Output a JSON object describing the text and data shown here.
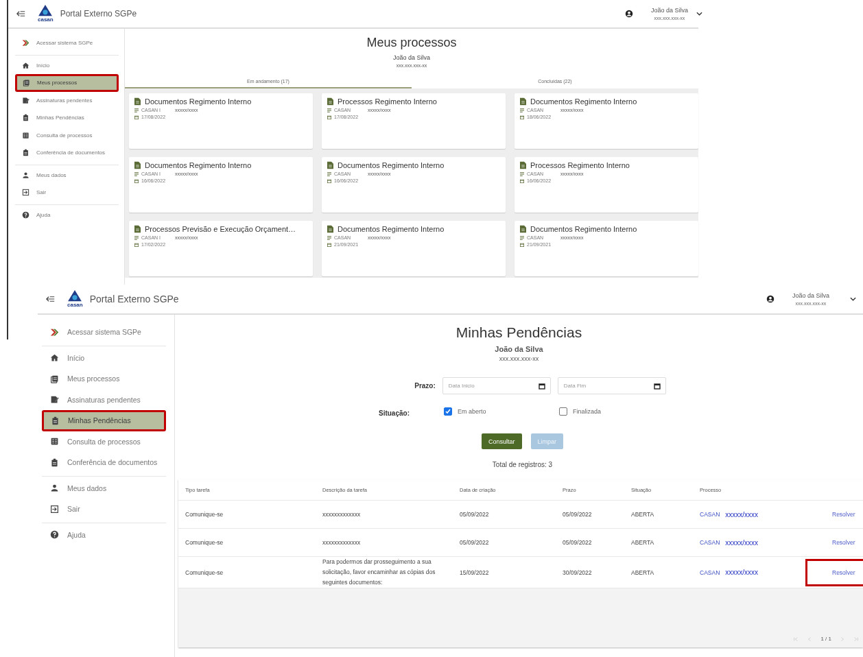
{
  "screens": [
    {
      "kind": "processes",
      "header": {
        "title": "Portal Externo SGPe",
        "logo_text": "casan",
        "user_name": "João da Silva",
        "user_id": "xxx.xxx.xxx-xx",
        "chevron": true
      },
      "sidebar": {
        "groups": [
          {
            "items": [
              {
                "label": "Acessar sistema SGPe",
                "selected": false,
                "highlighted": false
              }
            ]
          },
          {
            "items": [
              {
                "label": "Início",
                "selected": false,
                "highlighted": false
              },
              {
                "label": "Meus processos",
                "selected": true,
                "highlighted": true
              },
              {
                "label": "Assinaturas pendentes",
                "selected": false,
                "highlighted": false
              },
              {
                "label": "Minhas Pendências",
                "selected": false,
                "highlighted": false
              },
              {
                "label": "Consulta de processos",
                "selected": false,
                "highlighted": false
              },
              {
                "label": "Conferência de documentos",
                "selected": false,
                "highlighted": false
              }
            ]
          },
          {
            "items": [
              {
                "label": "Meus dados",
                "selected": false,
                "highlighted": false
              },
              {
                "label": "Sair",
                "selected": false,
                "highlighted": false
              }
            ]
          },
          {
            "items": [
              {
                "label": "Ajuda",
                "selected": false,
                "highlighted": false
              }
            ]
          }
        ]
      },
      "title": "Meus processos",
      "user_name": "João da Silva",
      "user_id": "xxx.xxx.xxx-xx",
      "tabs": [
        {
          "label": "Em andamento (17)",
          "selected": true
        },
        {
          "label": "Concluídas (22)",
          "selected": false
        }
      ],
      "cards": [
        {
          "title": "Documentos Regimento Interno",
          "org": "CASAN I",
          "number": "xxxxx/xxxx",
          "date": "17/08/2022"
        },
        {
          "title": "Processos Regimento Interno",
          "org": "CASAN",
          "number": "xxxxx/xxxx",
          "date": "17/08/2022"
        },
        {
          "title": "Documentos Regimento Interno",
          "org": "CASAN",
          "number": "xxxxx/xxxx",
          "date": "18/06/2022"
        },
        {
          "title": "Documentos Regimento Interno",
          "org": "CASAN I",
          "number": "xxxxx/xxxx",
          "date": "16/06/2022"
        },
        {
          "title": "Documentos Regimento Interno",
          "org": "CASAN",
          "number": "xxxxx/xxxx",
          "date": "16/06/2022"
        },
        {
          "title": "Processos Regimento Interno",
          "org": "CASAN",
          "number": "xxxxx/xxxx",
          "date": "16/06/2022"
        },
        {
          "title": "Processos Previsão e Execução Orçament…",
          "org": "CASAN I",
          "number": "xxxxx/xxxx",
          "date": "17/02/2022"
        },
        {
          "title": "Documentos Regimento Interno",
          "org": "CASAN",
          "number": "xxxxx/xxxx",
          "date": "21/09/2021"
        },
        {
          "title": "Documentos Regimento Interno",
          "org": "CASAN",
          "number": "xxxxx/xxxx",
          "date": "21/09/2021"
        }
      ]
    },
    {
      "kind": "pending",
      "header": {
        "title": "Portal Externo SGPe",
        "logo_text": "casan",
        "user_name": "João da Silva",
        "user_id": "xxx.xxx.xxx-xx",
        "chevron": true
      },
      "sidebar": {
        "groups": [
          {
            "items": [
              {
                "label": "Acessar sistema SGPe",
                "selected": false,
                "highlighted": false
              }
            ]
          },
          {
            "items": [
              {
                "label": "Início",
                "selected": false,
                "highlighted": false
              },
              {
                "label": "Meus processos",
                "selected": false,
                "highlighted": false
              },
              {
                "label": "Assinaturas pendentes",
                "selected": false,
                "highlighted": false
              },
              {
                "label": "Minhas Pendências",
                "selected": true,
                "highlighted": true
              },
              {
                "label": "Consulta de processos",
                "selected": false,
                "highlighted": false
              },
              {
                "label": "Conferência de documentos",
                "selected": false,
                "highlighted": false
              }
            ]
          },
          {
            "items": [
              {
                "label": "Meus dados",
                "selected": false,
                "highlighted": false
              },
              {
                "label": "Sair",
                "selected": false,
                "highlighted": false
              }
            ]
          },
          {
            "items": [
              {
                "label": "Ajuda",
                "selected": false,
                "highlighted": false
              }
            ]
          }
        ]
      },
      "title": "Minhas Pendências",
      "user_name": "João da Silva",
      "user_id": "xxx.xxx.xxx-xx",
      "filters": {
        "prazo_label": "Prazo:",
        "start": {
          "placeholder": "Data Inicio"
        },
        "end": {
          "placeholder": "Data Fim"
        },
        "situacao_label": "Situação:",
        "options": [
          {
            "label": "Em aberto",
            "checked": true
          },
          {
            "label": "Finalizada",
            "checked": false
          }
        ],
        "buttons": [
          {
            "label": "Consultar",
            "disabled": false
          },
          {
            "label": "Limpar",
            "disabled": true
          }
        ]
      },
      "total": "Total de registros: 3",
      "table": {
        "columns": [
          "Tipo tarefa",
          "Descrição da tarefa",
          "Data de criação",
          "Prazo",
          "Situação",
          "Processo"
        ],
        "rows": [
          {
            "type": "Comunique-se",
            "description": "xxxxxxxxxxxxx",
            "created": "05/09/2022",
            "deadline": "05/09/2022",
            "status": "ABERTA",
            "process_org": "CASAN",
            "process_number": "xxxxx/xxxx",
            "action": "Resolver",
            "highlighted": false
          },
          {
            "type": "Comunique-se",
            "description": "xxxxxxxxxxxxx",
            "created": "05/09/2022",
            "deadline": "05/09/2022",
            "status": "ABERTA",
            "process_org": "CASAN",
            "process_number": "xxxxx/xxxx",
            "action": "Resolver",
            "highlighted": false
          },
          {
            "type": "Comunique-se",
            "description": "Para podermos dar prosseguimento a sua solicitação, favor encaminhar as cópias dos seguintes documentos:",
            "created": "15/09/2022",
            "deadline": "30/09/2022",
            "status": "ABERTA",
            "process_org": "CASAN",
            "process_number": "xxxxx/xxxx",
            "action": "Resolver",
            "highlighted": true
          }
        ]
      },
      "pagination": "1 / 1"
    }
  ]
}
